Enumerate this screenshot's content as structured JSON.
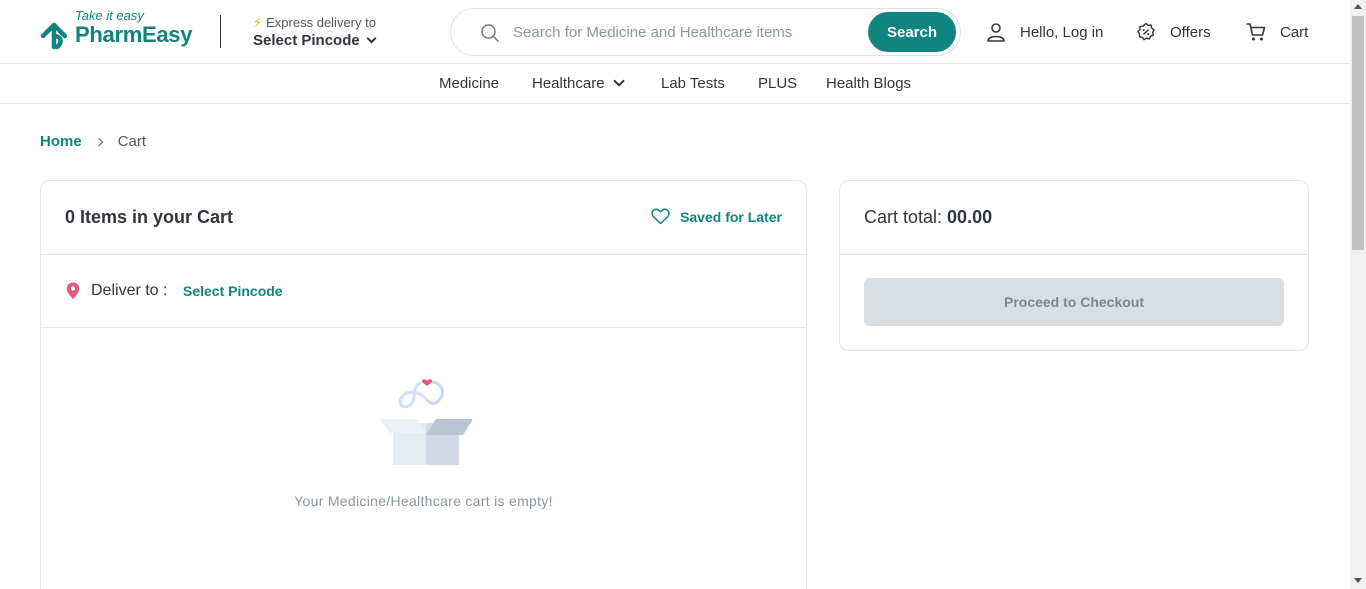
{
  "brand": {
    "tagline": "Take it easy",
    "name": "PharmEasy",
    "color": "#10847e"
  },
  "delivery": {
    "label": "Express delivery to",
    "value": "Select Pincode",
    "icon": "lightning-icon"
  },
  "search": {
    "placeholder": "Search for Medicine and Healthcare items",
    "button_label": "Search"
  },
  "header_links": {
    "login": "Hello, Log in",
    "offers": "Offers",
    "cart": "Cart"
  },
  "nav": {
    "items": [
      {
        "label": "Medicine"
      },
      {
        "label": "Healthcare"
      },
      {
        "label": "Lab Tests"
      },
      {
        "label": "PLUS"
      },
      {
        "label": "Health Blogs"
      }
    ]
  },
  "breadcrumb": {
    "home": "Home",
    "current": "Cart"
  },
  "cart": {
    "title": "0 Items in your Cart",
    "saved_for_later": "Saved for Later",
    "deliver_to_label": "Deliver to :",
    "deliver_to_value": "Select Pincode",
    "empty_message": "Your Medicine/Healthcare cart is empty!"
  },
  "summary": {
    "total_label": "Cart total:",
    "total_amount": "00.00",
    "checkout_label": "Proceed to Checkout"
  }
}
